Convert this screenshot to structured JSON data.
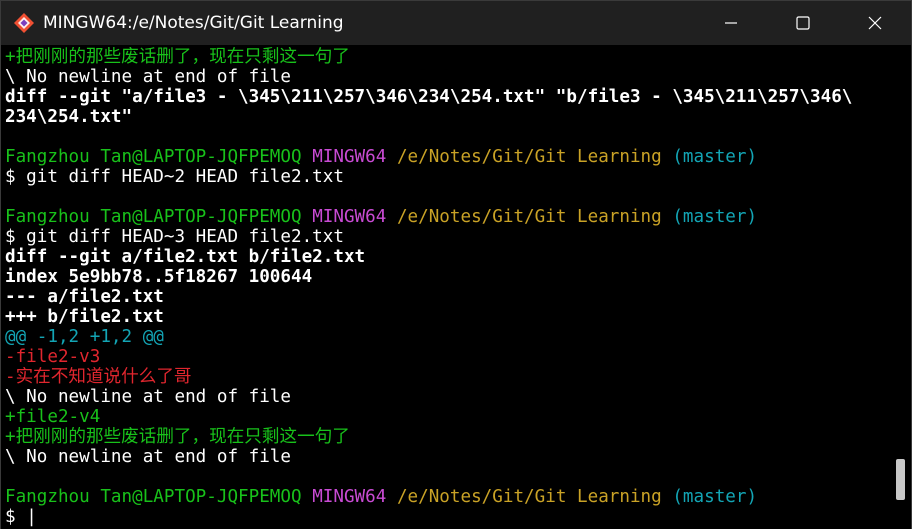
{
  "window": {
    "title": "MINGW64:/e/Notes/Git/Git Learning"
  },
  "terminal": {
    "lines": [
      [
        {
          "t": "+把刚刚的那些废话删了，现在只剩这一句了",
          "c": "green"
        }
      ],
      [
        {
          "t": "\\ No newline at end of file",
          "c": "white"
        }
      ],
      [
        {
          "t": "diff --git \"a/file3 - \\345\\211\\257\\346\\234\\254.txt\" \"b/file3 - \\345\\211\\257\\346\\",
          "c": "bold"
        }
      ],
      [
        {
          "t": "234\\254.txt\"",
          "c": "bold"
        }
      ],
      [],
      [
        {
          "t": "Fangzhou Tan@LAPTOP-JQFPEMOQ ",
          "c": "green"
        },
        {
          "t": "MINGW64 ",
          "c": "magenta"
        },
        {
          "t": "/e/Notes/Git/Git Learning ",
          "c": "yellow"
        },
        {
          "t": "(master)",
          "c": "cyan"
        }
      ],
      [
        {
          "t": "$ git diff HEAD~2 HEAD file2.txt",
          "c": "white"
        }
      ],
      [],
      [
        {
          "t": "Fangzhou Tan@LAPTOP-JQFPEMOQ ",
          "c": "green"
        },
        {
          "t": "MINGW64 ",
          "c": "magenta"
        },
        {
          "t": "/e/Notes/Git/Git Learning ",
          "c": "yellow"
        },
        {
          "t": "(master)",
          "c": "cyan"
        }
      ],
      [
        {
          "t": "$ git diff HEAD~3 HEAD file2.txt",
          "c": "white"
        }
      ],
      [
        {
          "t": "diff --git a/file2.txt b/file2.txt",
          "c": "bold"
        }
      ],
      [
        {
          "t": "index 5e9bb78..5f18267 100644",
          "c": "bold"
        }
      ],
      [
        {
          "t": "--- a/file2.txt",
          "c": "bold"
        }
      ],
      [
        {
          "t": "+++ b/file2.txt",
          "c": "bold"
        }
      ],
      [
        {
          "t": "@@ -1,2 +1,2 @@",
          "c": "cyan"
        }
      ],
      [
        {
          "t": "-file2-v3",
          "c": "red"
        }
      ],
      [
        {
          "t": "-实在不知道说什么了哥",
          "c": "red"
        }
      ],
      [
        {
          "t": "\\ No newline at end of file",
          "c": "white"
        }
      ],
      [
        {
          "t": "+file2-v4",
          "c": "green"
        }
      ],
      [
        {
          "t": "+把刚刚的那些废话删了，现在只剩这一句了",
          "c": "green"
        }
      ],
      [
        {
          "t": "\\ No newline at end of file",
          "c": "white"
        }
      ],
      [],
      [
        {
          "t": "Fangzhou Tan@LAPTOP-JQFPEMOQ ",
          "c": "green"
        },
        {
          "t": "MINGW64 ",
          "c": "magenta"
        },
        {
          "t": "/e/Notes/Git/Git Learning ",
          "c": "yellow"
        },
        {
          "t": "(master)",
          "c": "cyan"
        }
      ],
      [
        {
          "t": "$ ",
          "c": "white"
        },
        {
          "t": "|",
          "c": "cursor"
        }
      ]
    ]
  },
  "colors": {
    "background": "#000000",
    "prompt_user": "#18c11a",
    "prompt_msystem": "#c94bd4",
    "prompt_path": "#c9a226",
    "prompt_branch": "#13a5b5",
    "diff_removed": "#e0262e",
    "diff_added": "#18c11a"
  },
  "icons": {
    "app": "git-diamond-icon",
    "minimize": "minimize-icon",
    "maximize": "maximize-icon",
    "close": "close-icon"
  }
}
